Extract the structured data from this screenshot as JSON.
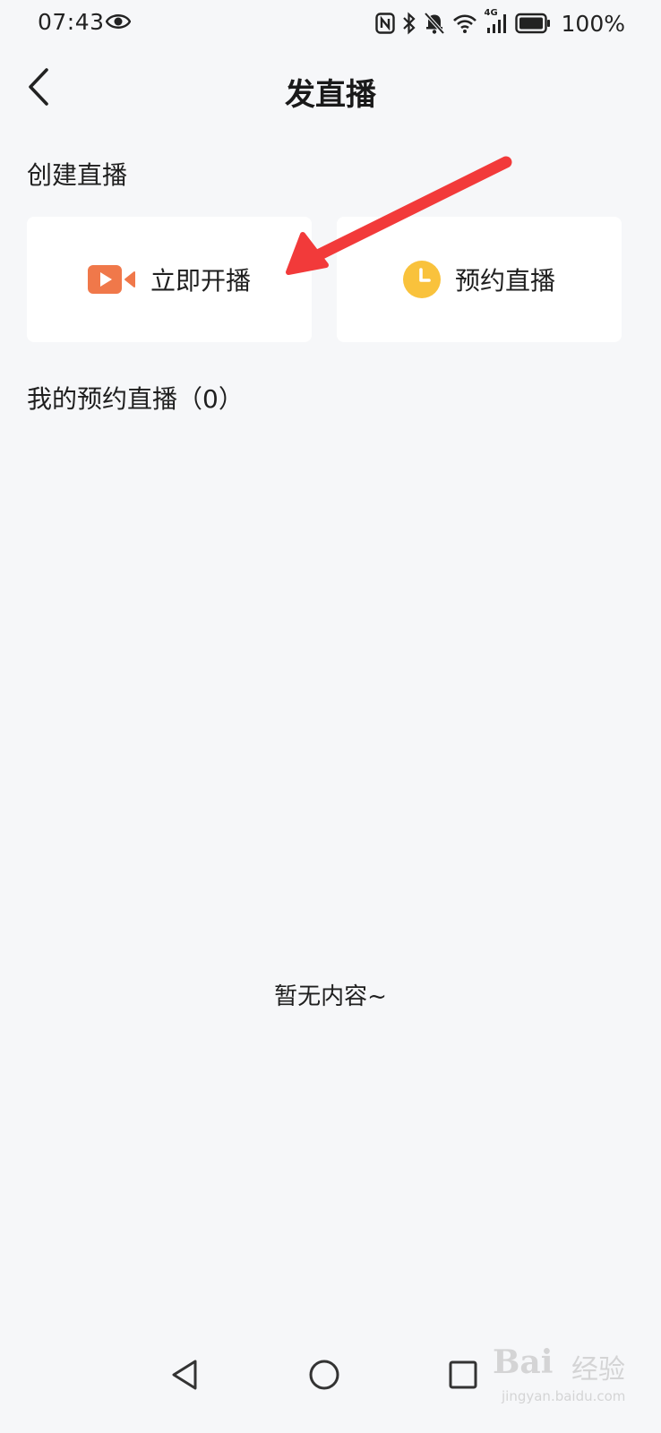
{
  "status_bar": {
    "time": "07:43",
    "battery": "100%",
    "signal_label": "4G",
    "icons": [
      "eye-icon",
      "nfc-icon",
      "bluetooth-icon",
      "bell-off-icon",
      "wifi-icon",
      "cellular-signal-icon",
      "battery-icon"
    ]
  },
  "header": {
    "title": "发直播"
  },
  "create_section": {
    "title": "创建直播",
    "cards": [
      {
        "label": "立即开播",
        "icon": "video-camera-icon",
        "color": "#F0784A"
      },
      {
        "label": "预约直播",
        "icon": "clock-icon",
        "color": "#F9C23C"
      }
    ]
  },
  "my_schedule": {
    "title": "我的预约直播（0）",
    "empty": "暂无内容~"
  },
  "annotation": {
    "color": "#F23A3A"
  },
  "system_nav": {
    "icons": [
      "nav-back-icon",
      "nav-home-icon",
      "nav-recent-icon"
    ]
  },
  "watermark": {
    "brand": "Bai",
    "sub": "经验",
    "url": "jingyan.baidu.com"
  }
}
